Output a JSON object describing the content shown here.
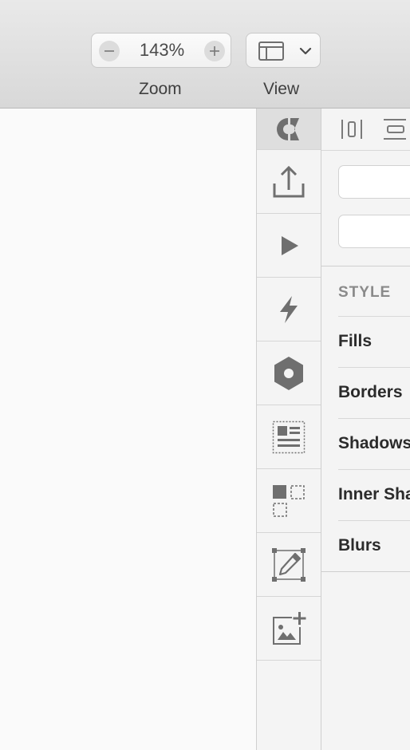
{
  "toolbar": {
    "zoom": {
      "value": "143%",
      "label": "Zoom",
      "decrease_icon": "minus-icon",
      "increase_icon": "plus-icon"
    },
    "view": {
      "label": "View",
      "icon": "layout-icon",
      "dropdown_icon": "chevron-down-icon"
    }
  },
  "rail": {
    "items": [
      {
        "icon": "inspector-logo-icon"
      },
      {
        "icon": "export-icon"
      },
      {
        "icon": "play-icon"
      },
      {
        "icon": "lightning-icon"
      },
      {
        "icon": "hexagon-icon"
      },
      {
        "icon": "text-layout-icon"
      },
      {
        "icon": "components-icon"
      },
      {
        "icon": "edit-icon"
      },
      {
        "icon": "add-image-icon"
      }
    ]
  },
  "inspector": {
    "style_header": "STYLE",
    "sections": [
      "Fills",
      "Borders",
      "Shadows",
      "Inner Shadows",
      "Blurs"
    ]
  },
  "colors": {
    "icon": "#6f6f6f",
    "toolbar_bg": "#e0e0e0",
    "panel_bg": "#f4f4f4",
    "canvas_bg": "#fafafa"
  }
}
